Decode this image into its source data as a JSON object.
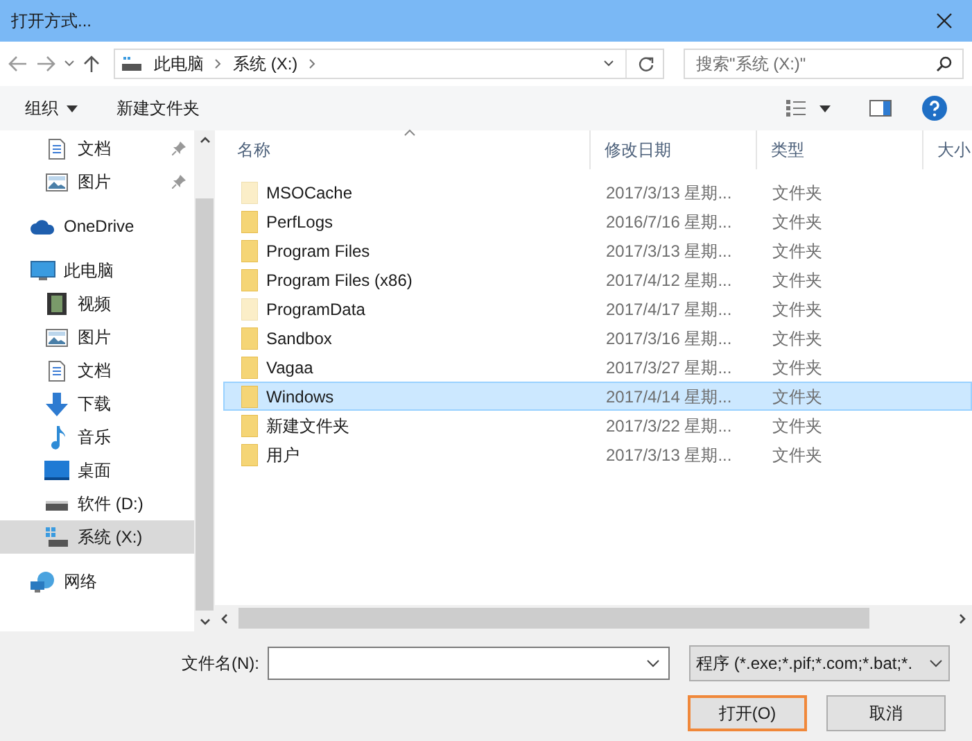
{
  "window": {
    "title": "打开方式..."
  },
  "address": {
    "crumbs": [
      "此电脑",
      "系统 (X:)"
    ]
  },
  "search": {
    "placeholder": "搜索\"系统 (X:)\""
  },
  "toolbar": {
    "organize": "组织",
    "new_folder": "新建文件夹"
  },
  "sidebar": {
    "items": [
      {
        "label": "文档",
        "kind": "doc",
        "pinned": true,
        "selected": false
      },
      {
        "label": "图片",
        "kind": "picture",
        "pinned": true,
        "selected": false
      },
      {
        "label": "OneDrive",
        "kind": "cloud",
        "pinned": false,
        "selected": false
      },
      {
        "label": "此电脑",
        "kind": "pc",
        "pinned": false,
        "selected": false,
        "children": [
          {
            "label": "视频",
            "kind": "video",
            "pinned": false,
            "selected": false
          },
          {
            "label": "图片",
            "kind": "picture",
            "pinned": false,
            "selected": false
          },
          {
            "label": "文档",
            "kind": "doc",
            "pinned": false,
            "selected": false
          },
          {
            "label": "下载",
            "kind": "download",
            "pinned": false,
            "selected": false
          },
          {
            "label": "音乐",
            "kind": "music",
            "pinned": false,
            "selected": false
          },
          {
            "label": "桌面",
            "kind": "desktop",
            "pinned": false,
            "selected": false
          },
          {
            "label": "软件 (D:)",
            "kind": "drive",
            "pinned": false,
            "selected": false
          },
          {
            "label": "系统 (X:)",
            "kind": "sysdrive",
            "pinned": false,
            "selected": true
          }
        ]
      },
      {
        "label": "网络",
        "kind": "network",
        "pinned": false,
        "selected": false
      }
    ]
  },
  "table": {
    "columns": [
      "名称",
      "修改日期",
      "类型",
      "大小"
    ],
    "rows": [
      {
        "name": "MSOCache",
        "date": "2017/3/13 星期...",
        "type": "文件夹",
        "hidden": true,
        "selected": false
      },
      {
        "name": "PerfLogs",
        "date": "2016/7/16 星期...",
        "type": "文件夹",
        "hidden": false,
        "selected": false
      },
      {
        "name": "Program Files",
        "date": "2017/3/13 星期...",
        "type": "文件夹",
        "hidden": false,
        "selected": false
      },
      {
        "name": "Program Files (x86)",
        "date": "2017/4/12 星期...",
        "type": "文件夹",
        "hidden": false,
        "selected": false
      },
      {
        "name": "ProgramData",
        "date": "2017/4/17 星期...",
        "type": "文件夹",
        "hidden": true,
        "selected": false
      },
      {
        "name": "Sandbox",
        "date": "2017/3/16 星期...",
        "type": "文件夹",
        "hidden": false,
        "selected": false
      },
      {
        "name": "Vagaa",
        "date": "2017/3/27 星期...",
        "type": "文件夹",
        "hidden": false,
        "selected": false
      },
      {
        "name": "Windows",
        "date": "2017/4/14 星期...",
        "type": "文件夹",
        "hidden": false,
        "selected": true
      },
      {
        "name": "新建文件夹",
        "date": "2017/3/22 星期...",
        "type": "文件夹",
        "hidden": false,
        "selected": false
      },
      {
        "name": "用户",
        "date": "2017/3/13 星期...",
        "type": "文件夹",
        "hidden": false,
        "selected": false
      }
    ]
  },
  "footer": {
    "filename_label": "文件名(N):",
    "filter": "程序 (*.exe;*.pif;*.com;*.bat;*.",
    "open": "打开(O)",
    "cancel": "取消"
  }
}
